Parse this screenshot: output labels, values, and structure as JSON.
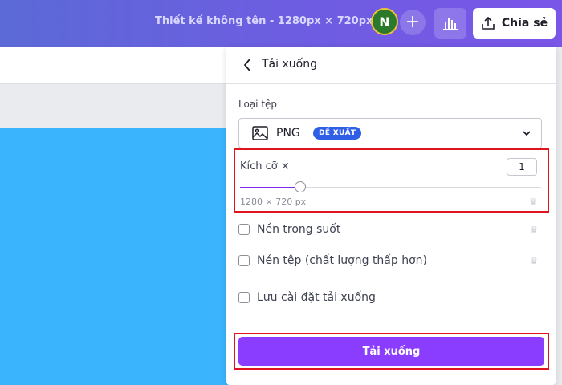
{
  "topbar": {
    "doc_title": "Thiết kế không tên - 1280px × 720px",
    "avatar_initial": "N",
    "add_label": "+",
    "share_label": "Chia sẻ"
  },
  "panel": {
    "title": "Tải xuống",
    "file_type": {
      "label": "Loại tệp",
      "value": "PNG",
      "badge": "ĐỀ XUẤT"
    },
    "size": {
      "label": "Kích cỡ ×",
      "value": "1",
      "dimensions": "1280 × 720 px",
      "slider_fraction": 0.2
    },
    "options": [
      {
        "label": "Nền trong suốt",
        "checked": false,
        "premium": true
      },
      {
        "label": "Nén tệp (chất lượng thấp hơn)",
        "checked": false,
        "premium": true
      },
      {
        "label": "Lưu cài đặt tải xuống",
        "checked": false,
        "premium": false
      }
    ],
    "download_label": "Tải xuống"
  },
  "colors": {
    "accent": "#8b3dff",
    "canvas": "#3ab5fd",
    "highlight": "#e0141e"
  }
}
